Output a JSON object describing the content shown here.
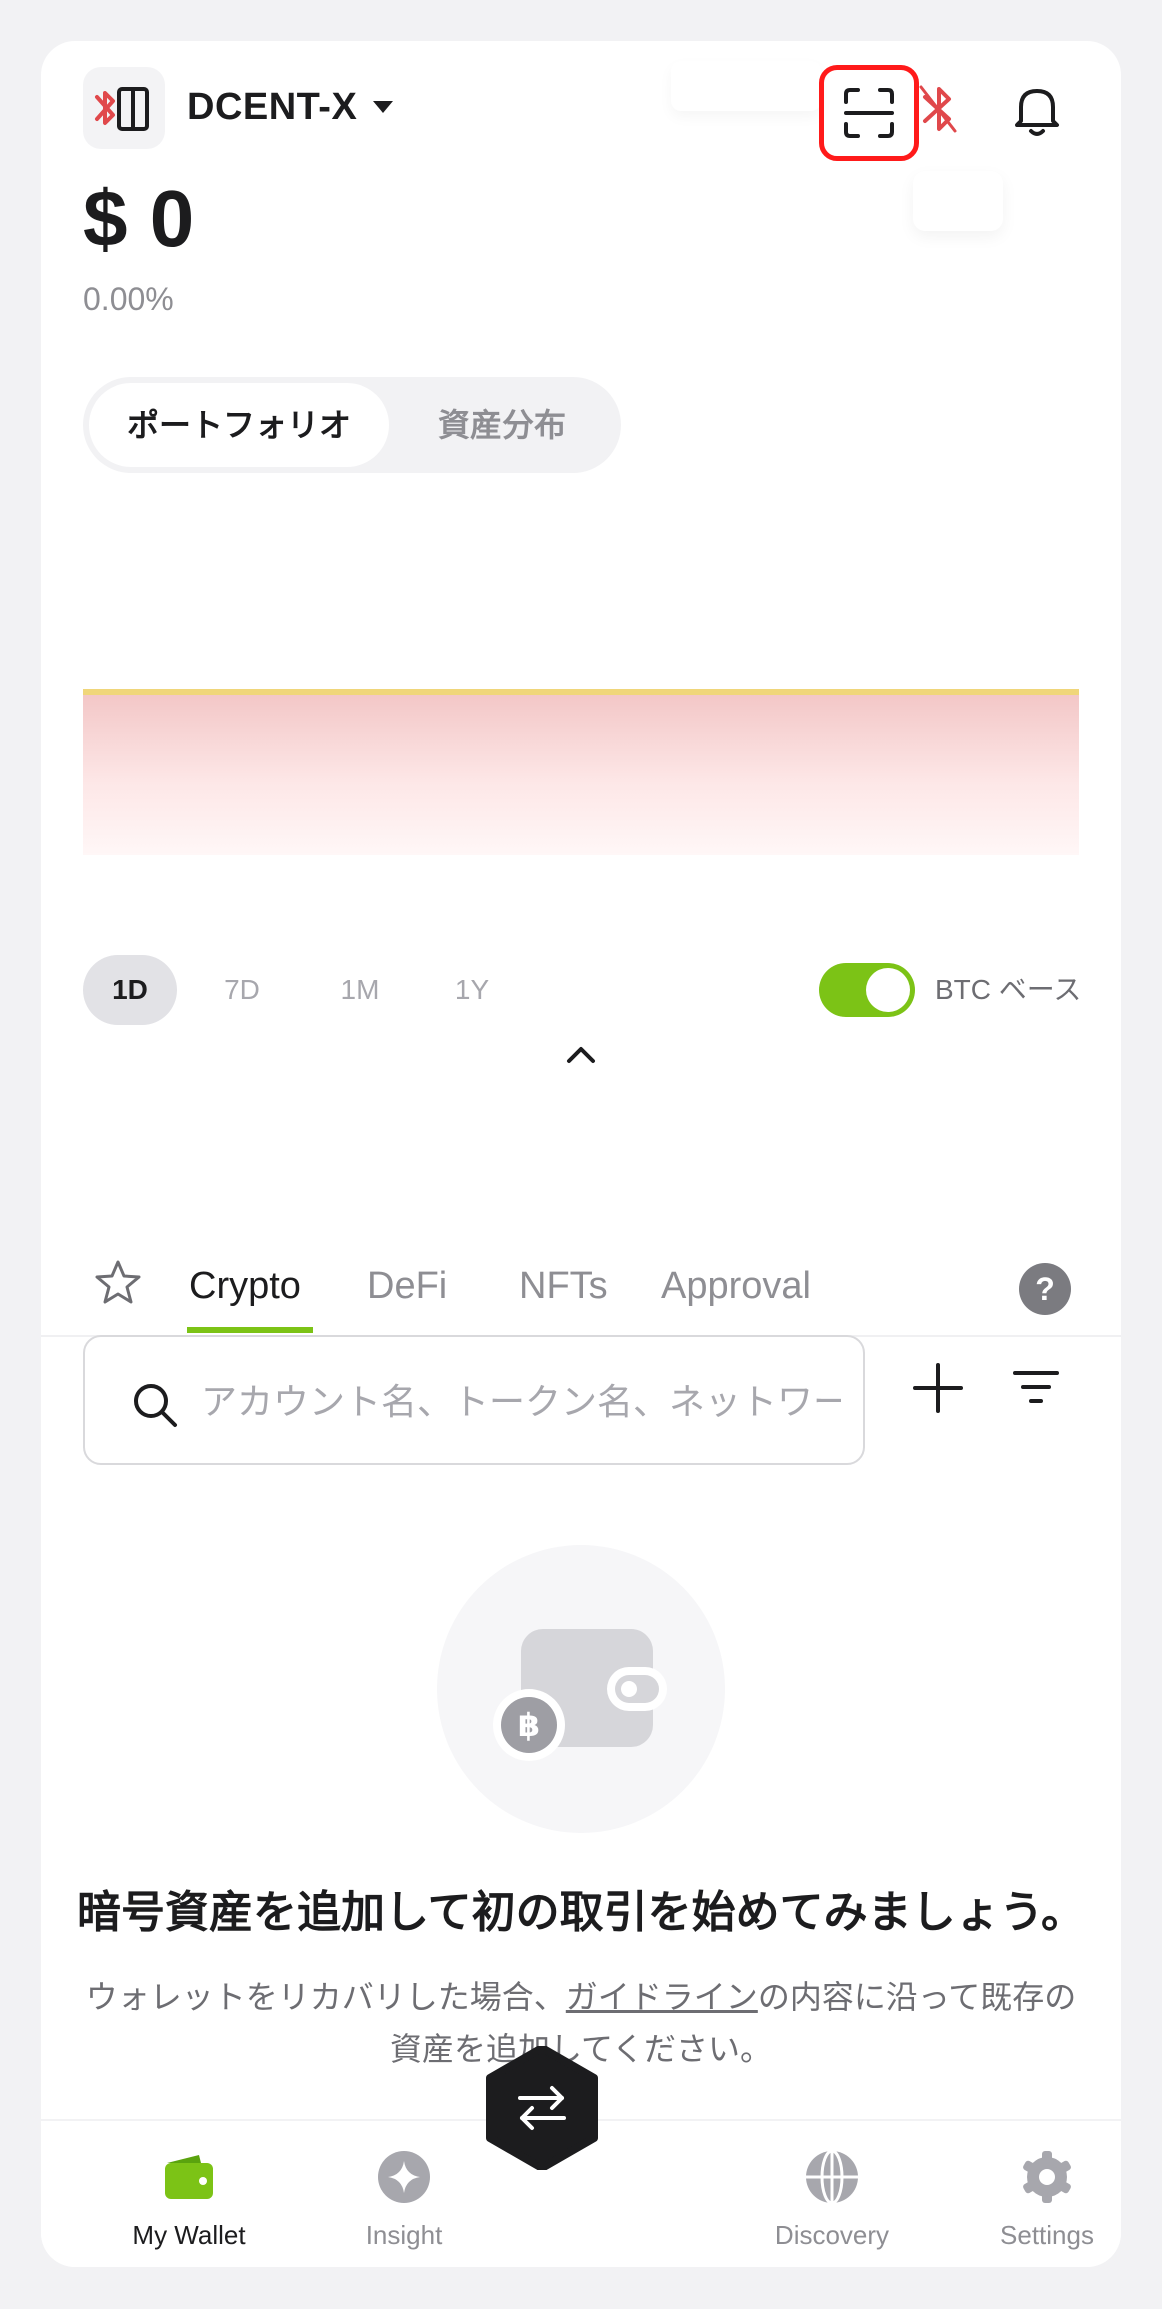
{
  "header": {
    "device_name": "DCENT-X"
  },
  "balance": {
    "amount": "$ 0",
    "change": "0.00%"
  },
  "segment": {
    "tabs": [
      "ポートフォリオ",
      "資産分布"
    ],
    "active": 0
  },
  "chart": {
    "ranges": [
      "1D",
      "7D",
      "1M",
      "1Y"
    ],
    "active_range": "1D",
    "btc_base_label": "BTC ベース",
    "btc_base_enabled": true
  },
  "asset_tabs": {
    "items": [
      "Crypto",
      "DeFi",
      "NFTs",
      "Approval"
    ],
    "active": "Crypto",
    "help": "?"
  },
  "search": {
    "placeholder": "アカウント名、トークン名、ネットワーク名",
    "value": ""
  },
  "empty_state": {
    "title": "暗号資産を追加して初の取引を始めてみましょう。",
    "desc_before": "ウォレットをリカバリした場合、",
    "desc_link": "ガイドライン",
    "desc_after": "の内容に沿って既存の資産を追加してください。"
  },
  "bottom_nav": {
    "items": [
      {
        "label": "My Wallet",
        "icon": "wallet-icon"
      },
      {
        "label": "Insight",
        "icon": "sparkle-icon"
      },
      {
        "label": "Discovery",
        "icon": "globe-icon"
      },
      {
        "label": "Settings",
        "icon": "gear-icon"
      }
    ],
    "active": "My Wallet",
    "swap_icon": "swap-icon"
  },
  "colors": {
    "accent": "#7cc316",
    "highlight": "#ff1a1a",
    "bluetooth": "#e0484b"
  }
}
